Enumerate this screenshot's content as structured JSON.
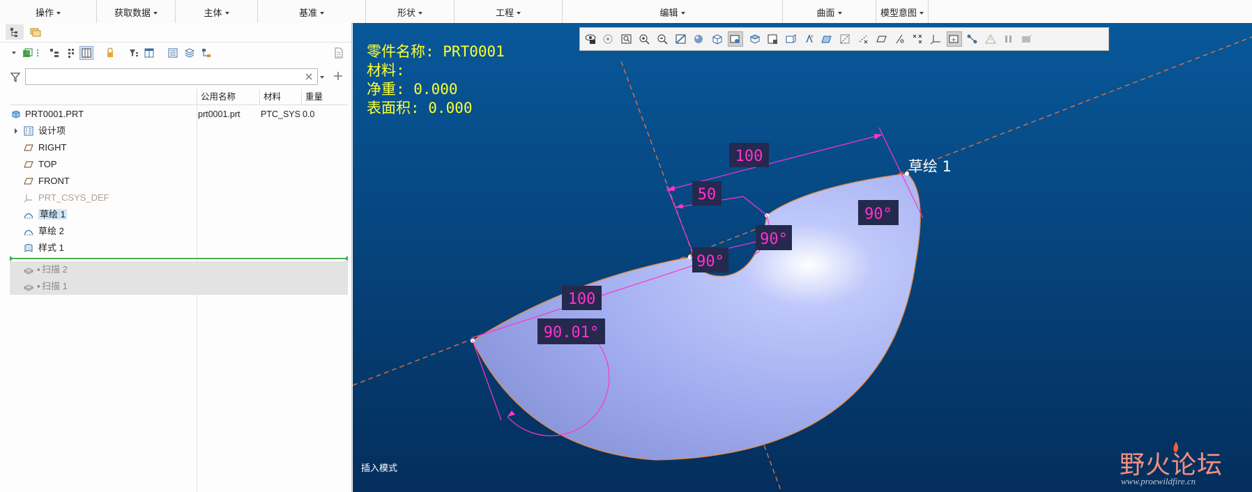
{
  "ribbon": {
    "groups": [
      "操作",
      "获取数据",
      "主体",
      "基准",
      "形状",
      "工程",
      "编辑",
      "曲面",
      "模型意图"
    ]
  },
  "tree": {
    "search": {
      "value": "",
      "placeholder": ""
    },
    "columns": [
      "公用名称",
      "材料",
      "重量"
    ],
    "root": {
      "name": "PRT0001.PRT",
      "common_name": "prt0001.prt",
      "material": "PTC_SYS",
      "weight": "0.0"
    },
    "items": [
      {
        "label": "设计项",
        "icon": "design-items-icon"
      },
      {
        "label": "RIGHT",
        "icon": "datum-plane-icon"
      },
      {
        "label": "TOP",
        "icon": "datum-plane-icon"
      },
      {
        "label": "FRONT",
        "icon": "datum-plane-icon"
      },
      {
        "label": "PRT_CSYS_DEF",
        "icon": "csys-icon"
      },
      {
        "label": "草绘 1",
        "icon": "sketch-icon"
      },
      {
        "label": "草绘 2",
        "icon": "sketch-icon"
      },
      {
        "label": "样式 1",
        "icon": "style-icon"
      }
    ],
    "suppressed": [
      {
        "label": "扫描 2",
        "icon": "sweep-icon"
      },
      {
        "label": "扫描 1",
        "icon": "sweep-icon"
      }
    ]
  },
  "model_info": {
    "name_line": "零件名称: PRT0001",
    "material_line": "材料:",
    "mass_line": "净重: 0.000",
    "area_line": "表面积: 0.000"
  },
  "dimensions": {
    "d_100_top": "100",
    "d_50": "50",
    "d_90_right": "90°",
    "d_90_mid": "90°",
    "d_90_left": "90°",
    "d_100_left": "100",
    "d_90_01": "90.01°"
  },
  "sketch_label": "草绘 1",
  "status": {
    "mode": "插入模式"
  },
  "watermark": {
    "main": "野火论坛",
    "url": "www.proewildfire.cn"
  },
  "colors": {
    "dimension": "#ff33cc",
    "info_text": "#ffff33",
    "surface": "#a6b2f2",
    "centerline": "#e8783a"
  }
}
